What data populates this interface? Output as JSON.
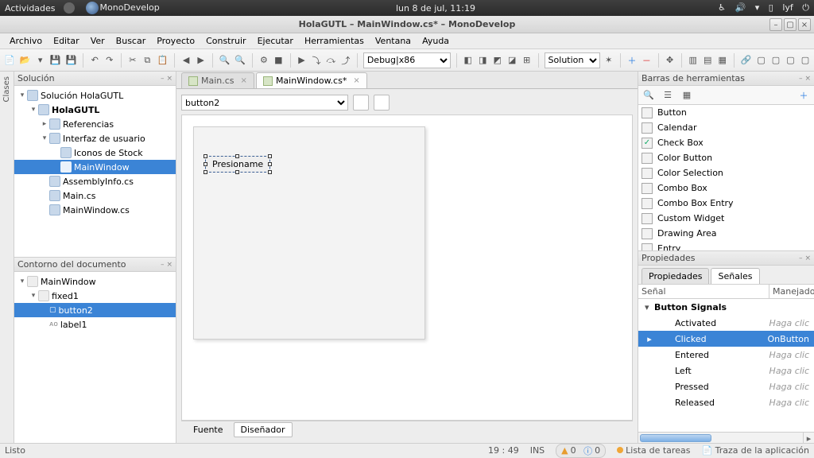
{
  "gnome": {
    "activities": "Actividades",
    "app_running": "MonoDevelop",
    "clock": "lun  8 de jul, 11:19",
    "user": "lyf"
  },
  "window": {
    "title": "HolaGUTL – MainWindow.cs* – MonoDevelop"
  },
  "menu": [
    "Archivo",
    "Editar",
    "Ver",
    "Buscar",
    "Proyecto",
    "Construir",
    "Ejecutar",
    "Herramientas",
    "Ventana",
    "Ayuda"
  ],
  "toolbar": {
    "config_select": "Debug|x86",
    "view_select": "Solution"
  },
  "left_strip_label": "Clases",
  "solution": {
    "title": "Solución",
    "nodes": [
      {
        "indent": 0,
        "exp": "▾",
        "label": "Solución HolaGUTL",
        "bold": false
      },
      {
        "indent": 1,
        "exp": "▾",
        "label": "HolaGUTL",
        "bold": true
      },
      {
        "indent": 2,
        "exp": "▸",
        "label": "Referencias"
      },
      {
        "indent": 2,
        "exp": "▾",
        "label": "Interfaz de usuario"
      },
      {
        "indent": 3,
        "exp": "",
        "label": "Iconos de Stock"
      },
      {
        "indent": 3,
        "exp": "",
        "label": "MainWindow",
        "selected": true
      },
      {
        "indent": 2,
        "exp": "",
        "label": "AssemblyInfo.cs"
      },
      {
        "indent": 2,
        "exp": "",
        "label": "Main.cs"
      },
      {
        "indent": 2,
        "exp": "",
        "label": "MainWindow.cs"
      }
    ]
  },
  "outline": {
    "title": "Contorno del documento",
    "nodes": [
      {
        "indent": 0,
        "exp": "▾",
        "label": "MainWindow"
      },
      {
        "indent": 1,
        "exp": "▾",
        "label": "fixed1"
      },
      {
        "indent": 2,
        "exp": "",
        "label": "button2",
        "selected": true,
        "prefix": "▢"
      },
      {
        "indent": 2,
        "exp": "",
        "label": "label1",
        "prefix": "ᴀᴏ"
      }
    ]
  },
  "tabs": [
    {
      "label": "Main.cs",
      "active": false
    },
    {
      "label": "MainWindow.cs*",
      "active": true
    }
  ],
  "designer": {
    "object_select": "button2",
    "widget_text": "Presioname",
    "footer": {
      "source": "Fuente",
      "designer": "Diseñador",
      "active": "Diseñador"
    }
  },
  "toolbox": {
    "title": "Barras de herramientas",
    "items": [
      "Button",
      "Calendar",
      "Check Box",
      "Color Button",
      "Color Selection",
      "Combo Box",
      "Combo Box Entry",
      "Custom Widget",
      "Drawing Area",
      "Entry"
    ]
  },
  "properties": {
    "title": "Propiedades",
    "tab_props": "Propiedades",
    "tab_signals": "Señales",
    "col_signal": "Señal",
    "col_handler": "Manejador",
    "group": "Button Signals",
    "signals": [
      {
        "name": "Activated",
        "handler": "Haga clic"
      },
      {
        "name": "Clicked",
        "handler": "OnButton",
        "selected": true
      },
      {
        "name": "Entered",
        "handler": "Haga clic"
      },
      {
        "name": "Left",
        "handler": "Haga clic"
      },
      {
        "name": "Pressed",
        "handler": "Haga clic"
      },
      {
        "name": "Released",
        "handler": "Haga clic"
      }
    ]
  },
  "status": {
    "ready": "Listo",
    "cursor": "19 : 49",
    "insert": "INS",
    "warn_count": "0",
    "info_count": "0",
    "tasks": "Lista de tareas",
    "trace": "Traza de la aplicación"
  }
}
